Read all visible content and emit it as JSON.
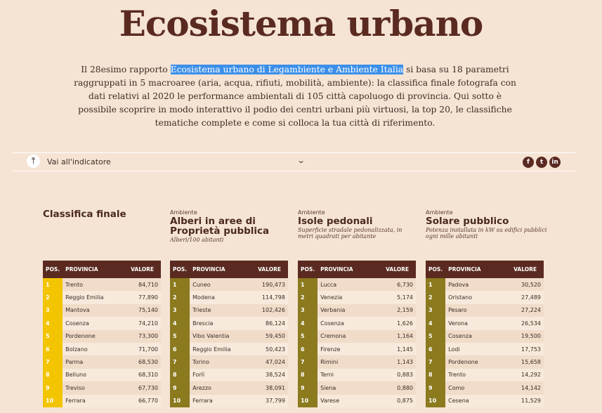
{
  "page": {
    "title": "Ecosistema urbano",
    "intro_before": "Il 28esimo rapporto ",
    "intro_link": "Ecosistema urbano di Legambiente e Ambiente Italia",
    "intro_after": " si basa su 18 parametri raggruppati in 5 macroaree (aria, acqua, rifiuti, mobilità, ambiente): la classifica finale fotografa con dati relativi al 2020 le performance ambientali di 105 città capoluogo di provincia. Qui sotto è possibile scoprire in modo interattivo il podio dei centri urbani più virtuosi, la top 20, le classifiche tematiche complete e come si colloca la tua città di riferimento."
  },
  "toolbar": {
    "select_label": "Vai all'indicatore",
    "top_icon": "arrow-up-to-top-icon",
    "chevron_icon": "chevron-down-icon",
    "share": [
      "f",
      "t",
      "in"
    ]
  },
  "colors": {
    "background": "#f5e4d4",
    "header": "#5a2a20",
    "pos_final": "#f2c500",
    "pos_theme": "#8b7a1e",
    "row_a": "#f0dcc9",
    "row_b": "#f7e9db"
  },
  "columns": {
    "labels": {
      "pos": "POS.",
      "prov": "PROVINCIA",
      "val": "VALORE"
    }
  },
  "final": {
    "title": "Classifica finale",
    "rows": [
      [
        "1",
        "Trento",
        "84,710"
      ],
      [
        "2",
        "Reggio Emilia",
        "77,890"
      ],
      [
        "3",
        "Mantova",
        "75,140"
      ],
      [
        "4",
        "Cosenza",
        "74,210"
      ],
      [
        "5",
        "Pordenone",
        "73,300"
      ],
      [
        "6",
        "Bolzano",
        "71,700"
      ],
      [
        "7",
        "Parma",
        "68,530"
      ],
      [
        "8",
        "Belluno",
        "68,310"
      ],
      [
        "9",
        "Treviso",
        "67,730"
      ],
      [
        "10",
        "Ferrara",
        "66,770"
      ]
    ]
  },
  "alberi": {
    "category": "Ambiente",
    "title": "Alberi in aree di Proprietà pubblica",
    "subtitle": "Alberi/100 abitanti",
    "rows": [
      [
        "1",
        "Cuneo",
        "190,473"
      ],
      [
        "2",
        "Modena",
        "114,798"
      ],
      [
        "3",
        "Trieste",
        "102,426"
      ],
      [
        "4",
        "Brescia",
        "86,124"
      ],
      [
        "5",
        "Vibo Valentia",
        "59,450"
      ],
      [
        "6",
        "Reggio Emilia",
        "50,423"
      ],
      [
        "7",
        "Torino",
        "47,024"
      ],
      [
        "8",
        "Forlì",
        "38,524"
      ],
      [
        "9",
        "Arezzo",
        "38,091"
      ],
      [
        "10",
        "Ferrara",
        "37,799"
      ]
    ]
  },
  "isole": {
    "category": "Ambiente",
    "title": "Isole pedonali",
    "subtitle": "Superficie stradale pedonalizzata, in metri quadrati per abitante",
    "rows": [
      [
        "1",
        "Lucca",
        "6,730"
      ],
      [
        "2",
        "Venezia",
        "5,174"
      ],
      [
        "3",
        "Verbania",
        "2,159"
      ],
      [
        "4",
        "Cosenza",
        "1,626"
      ],
      [
        "5",
        "Cremona",
        "1,164"
      ],
      [
        "6",
        "Firenze",
        "1,145"
      ],
      [
        "7",
        "Rimini",
        "1,143"
      ],
      [
        "8",
        "Terni",
        "0,883"
      ],
      [
        "9",
        "Siena",
        "0,880"
      ],
      [
        "10",
        "Varese",
        "0,875"
      ]
    ]
  },
  "solare": {
    "category": "Ambiente",
    "title": "Solare pubblico",
    "subtitle": "Potenza installata in kW su edifici pubblici ogni mille abitanti",
    "rows": [
      [
        "1",
        "Padova",
        "30,520"
      ],
      [
        "2",
        "Oristano",
        "27,489"
      ],
      [
        "3",
        "Pesaro",
        "27,224"
      ],
      [
        "4",
        "Verona",
        "26,534"
      ],
      [
        "5",
        "Cosenza",
        "19,500"
      ],
      [
        "6",
        "Lodi",
        "17,753"
      ],
      [
        "7",
        "Pordenone",
        "15,658"
      ],
      [
        "8",
        "Trento",
        "14,292"
      ],
      [
        "9",
        "Como",
        "14,142"
      ],
      [
        "10",
        "Cesena",
        "11,529"
      ]
    ]
  }
}
